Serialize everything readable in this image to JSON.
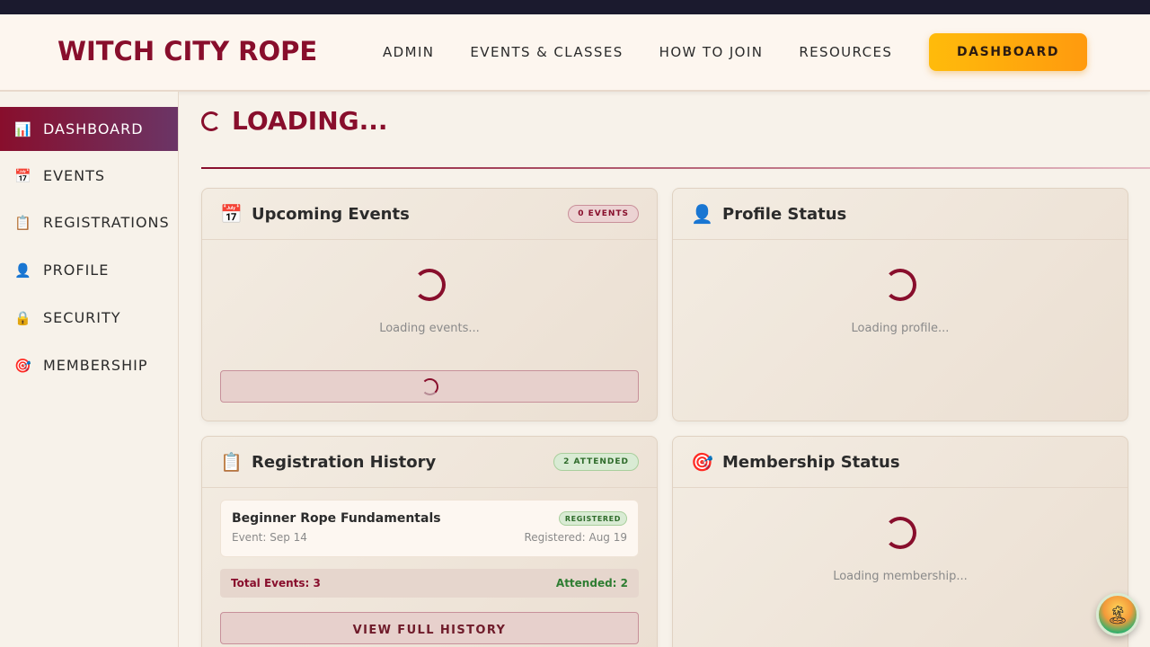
{
  "header": {
    "logo": "WITCH CITY ROPE",
    "nav": [
      "ADMIN",
      "EVENTS & CLASSES",
      "HOW TO JOIN",
      "RESOURCES"
    ],
    "dashboard_button": "DASHBOARD"
  },
  "sidebar": {
    "items": [
      {
        "icon": "📊",
        "icon_name": "bar-chart-icon",
        "label": "DASHBOARD",
        "active": true
      },
      {
        "icon": "📅",
        "icon_name": "calendar-icon",
        "label": "EVENTS"
      },
      {
        "icon": "📋",
        "icon_name": "clipboard-icon",
        "label": "REGISTRATIONS"
      },
      {
        "icon": "👤",
        "icon_name": "user-icon",
        "label": "PROFILE"
      },
      {
        "icon": "🔒",
        "icon_name": "lock-icon",
        "label": "SECURITY"
      },
      {
        "icon": "🎯",
        "icon_name": "target-icon",
        "label": "MEMBERSHIP"
      }
    ]
  },
  "main": {
    "title": "LOADING..."
  },
  "cards": {
    "upcoming": {
      "icon": "📅",
      "title": "Upcoming Events",
      "badge": "0 EVENTS",
      "loading": "Loading events..."
    },
    "profile": {
      "icon": "👤",
      "title": "Profile Status",
      "loading": "Loading profile..."
    },
    "registration": {
      "icon": "📋",
      "title": "Registration History",
      "badge": "2 ATTENDED",
      "item": {
        "title": "Beginner Rope Fundamentals",
        "status": "REGISTERED",
        "event": "Event: Sep 14",
        "registered": "Registered: Aug 19"
      },
      "total": "Total Events: 3",
      "attended": "Attended: 2",
      "button": "VIEW FULL HISTORY"
    },
    "membership": {
      "icon": "🎯",
      "title": "Membership Status",
      "loading": "Loading membership..."
    }
  },
  "colors": {
    "brand": "#880e2c",
    "accent": "#ffb00c",
    "success": "#2e6b2a"
  },
  "fab": {
    "icon": "🏝"
  }
}
